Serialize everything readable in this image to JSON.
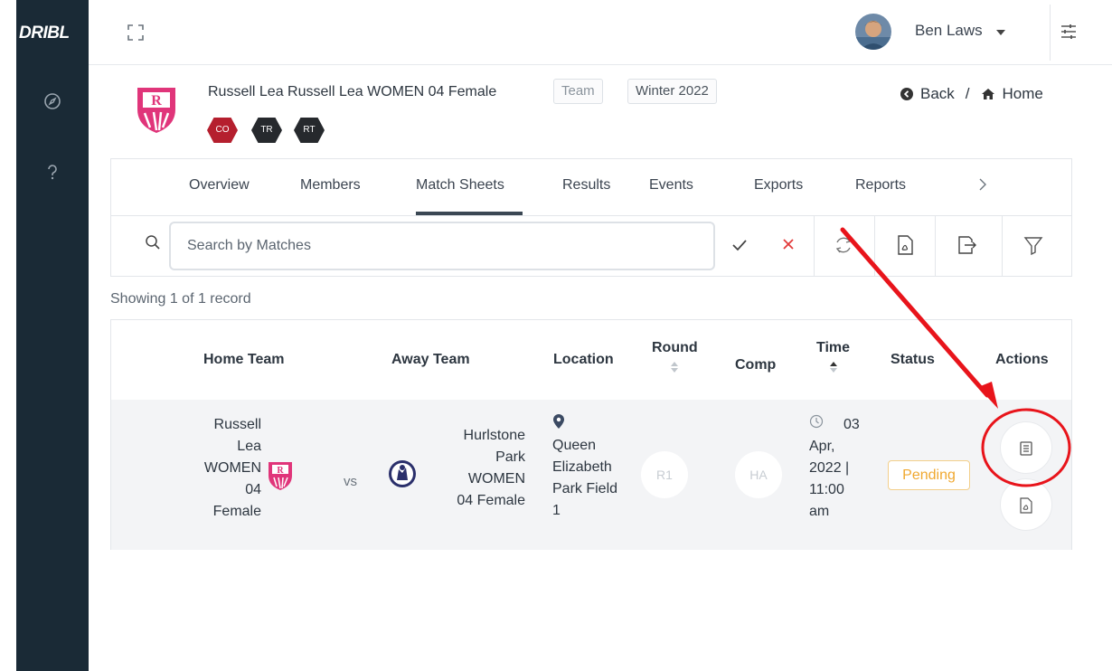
{
  "sidebar": {
    "logo": "DRIBL",
    "items": [
      {
        "icon": "compass-icon"
      },
      {
        "icon": "help-icon"
      }
    ]
  },
  "topbar": {
    "user_name": "Ben Laws",
    "icons": [
      "expand-icon",
      "settings-sliders-icon"
    ]
  },
  "team": {
    "title": "Russell Lea Russell Lea WOMEN 04 Female",
    "type_chip": "Team",
    "season_chip": "Winter 2022",
    "tags": [
      {
        "label": "CO",
        "color": "#b51f2e"
      },
      {
        "label": "TR",
        "color": "#26292d"
      },
      {
        "label": "RT",
        "color": "#26292d"
      }
    ],
    "back_label": "Back",
    "separator": "/",
    "home_label": "Home"
  },
  "tabs": [
    "Overview",
    "Members",
    "Match Sheets",
    "Results",
    "Events",
    "Exports",
    "Reports"
  ],
  "active_tab": "Match Sheets",
  "search": {
    "placeholder": "Search by Matches",
    "value": ""
  },
  "record_count": "Showing 1 of 1 record",
  "table": {
    "headers": [
      "Home Team",
      "Away Team",
      "Location",
      "Round",
      "Comp",
      "Time",
      "Status",
      "Actions"
    ],
    "rows": [
      {
        "home_team_lines": [
          "Russell",
          "Lea",
          "WOMEN",
          "04",
          "Female"
        ],
        "vs": "vs",
        "away_team_lines": [
          "Hurlstone",
          "Park",
          "WOMEN",
          "04 Female"
        ],
        "location_lines": [
          "Queen",
          "Elizabeth",
          "Park Field",
          "1"
        ],
        "round": "R1",
        "comp": "HA",
        "time_lines": [
          "03",
          "Apr,",
          "2022 |",
          "11:00",
          "am"
        ],
        "status": "Pending"
      }
    ]
  },
  "colors": {
    "sidebar": "#1a2a36",
    "annotation": "#e8141b",
    "pending": "#f0a830"
  }
}
